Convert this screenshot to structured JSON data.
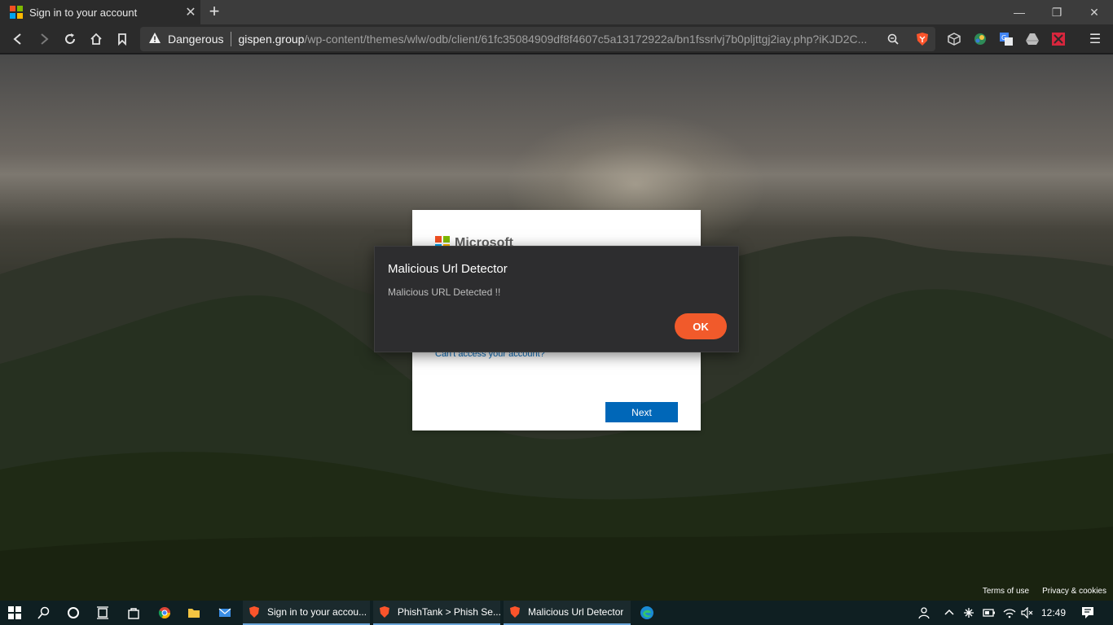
{
  "browser": {
    "tab": {
      "title": "Sign in to your account",
      "close_glyph": "✕"
    },
    "new_tab_glyph": "+",
    "window_controls": {
      "minimize": "—",
      "restore": "❐",
      "close": "✕"
    },
    "omnibox": {
      "security_label": "Dangerous",
      "host": "gispen.group",
      "path": "/wp-content/themes/wlw/odb/client/61fc35084909df8f4607c5a13172922a/bn1fssrlvj7b0pljttgj2iay.php?iKJD2C..."
    },
    "toolbar_icons": [
      "back-icon",
      "forward-icon",
      "reload-icon",
      "home-icon",
      "bookmark-icon",
      "zoom-icon",
      "brave-shield-icon"
    ],
    "extensions": [
      "cube-extension-icon",
      "globe-extension-icon",
      "translate-extension-icon",
      "drive-extension-icon",
      "red-extension-icon"
    ],
    "menu_glyph": "☰"
  },
  "page": {
    "signin": {
      "brand": "Microsoft",
      "cant_access": "Can't access your account?",
      "next_label": "Next"
    },
    "footer": {
      "terms": "Terms of use",
      "privacy": "Privacy & cookies"
    }
  },
  "dialog": {
    "title": "Malicious Url Detector",
    "message": "Malicious URL Detected !!",
    "ok_label": "OK"
  },
  "taskbar": {
    "tasks": [
      {
        "label": "Sign in to your accou..."
      },
      {
        "label": "PhishTank > Phish Se..."
      },
      {
        "label": "Malicious Url Detector"
      }
    ],
    "clock": "12:49"
  },
  "colors": {
    "ms_red": "#f25022",
    "ms_green": "#7fba00",
    "ms_blue": "#00a4ef",
    "ms_yellow": "#ffb900",
    "ok_button": "#f15a2b",
    "next_button": "#0067b8",
    "brave_orange": "#fb542b"
  }
}
